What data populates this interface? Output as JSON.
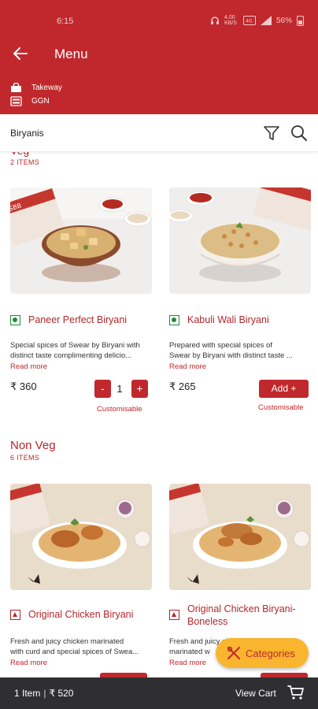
{
  "status": {
    "time": "6:15",
    "network": "4.00 KB/S",
    "battery": "56%"
  },
  "header": {
    "title": "Menu"
  },
  "order": {
    "mode": "Takeway",
    "location": "GGN"
  },
  "search_bar": {
    "category": "Biryanis"
  },
  "sections": [
    {
      "title": "Veg",
      "count": "2 ITEMS",
      "items": [
        {
          "name": "Paneer Perfect Biryani",
          "desc_line1": "Special spices of Swear by Biryani with",
          "desc_line2": "distinct taste complimenting delicio...",
          "read_more": "Read more",
          "price": "₹ 360",
          "action": "stepper",
          "minus": "-",
          "qty": "1",
          "plus": "+",
          "customisable": "Customisable"
        },
        {
          "name": "Kabuli Wali Biryani",
          "desc_line1": "Prepared with special spices of",
          "desc_line2": "Swear by Biryani with distinct taste ...",
          "read_more": "Read more",
          "price": "₹ 265",
          "action": "Add +",
          "customisable": "Customisable"
        }
      ]
    },
    {
      "title": "Non Veg",
      "count": "6 ITEMS",
      "items": [
        {
          "name": "Original Chicken Biryani",
          "desc_line1": "Fresh and juicy chicken marinated",
          "desc_line2": "with curd and special spices of Swea...",
          "read_more": "Read more"
        },
        {
          "name_line1": "Original Chicken Biryani-",
          "name_line2": "Boneless",
          "desc_line1": "Fresh and juicy chicken",
          "desc_line2": "marinated w",
          "read_more": "Read more"
        }
      ]
    }
  ],
  "categories_button": "Categories",
  "cart": {
    "summary": "1 Item",
    "total": "₹ 520",
    "view_label": "View Cart"
  },
  "colors": {
    "brand_red": "#c0282d",
    "accent_yellow": "#f9b52d",
    "veg_green": "#1f8a3b",
    "cart_bar": "#2f2f31"
  }
}
